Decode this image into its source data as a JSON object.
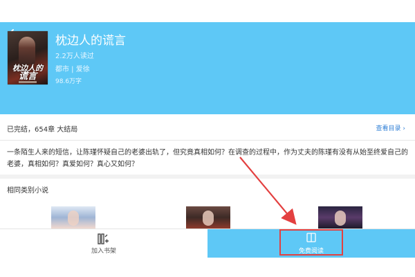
{
  "header": {
    "back_icon": "arrow-left-icon",
    "bg_color": "#5ec8f6"
  },
  "book": {
    "title": "枕边人的谎言",
    "readers": "2.2万人读过",
    "category": "都市 | 爱徐",
    "word_count": "98.6万字",
    "cover_title_line1": "枕边人的",
    "cover_title_line2": "谎言"
  },
  "status": {
    "text": "已完结，654章 大结局",
    "catalog_link": "查看目录 ›"
  },
  "description": "一条陌生人来的短信，让陈瑾怀疑自己的老婆出轨了，但究竟真相如何？在调查的过程中，作为丈夫的陈瑾有没有从始至终爱自己的老婆，真相如何？真爱如何？真心又如何？",
  "similar": {
    "title": "相同类别小说"
  },
  "bottom_bar": {
    "shelf_label": "加入书架",
    "shelf_icon": "bookshelf-icon",
    "read_label": "免费阅读",
    "read_icon": "book-icon",
    "highlight_color": "#e34040"
  }
}
